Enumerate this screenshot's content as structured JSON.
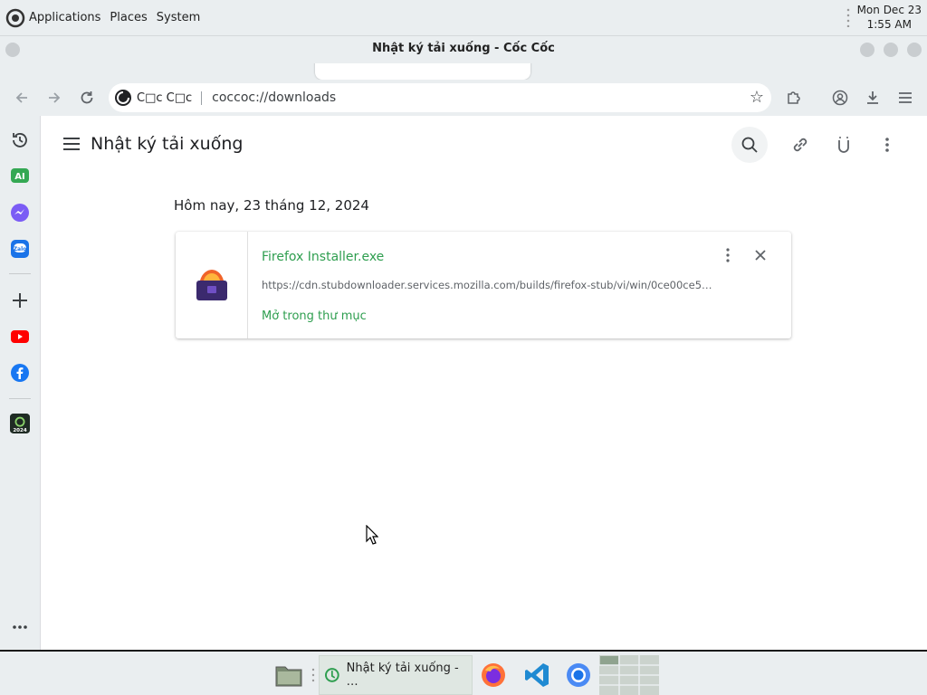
{
  "system_panel": {
    "menus": [
      "Applications",
      "Places",
      "System"
    ],
    "clock": {
      "date": "Mon Dec 23",
      "time": "1:55 AM"
    }
  },
  "window": {
    "title": "Nhật ký tải xuống - Cốc Cốc"
  },
  "toolbar": {
    "site_name": "C□c C□c",
    "url": "coccoc://downloads"
  },
  "sidebar": {
    "items": [
      "history",
      "ai",
      "messenger",
      "zalo",
      "add",
      "youtube",
      "facebook",
      "coccoc-2024",
      "more"
    ]
  },
  "downloads": {
    "heading": "Nhật ký tải xuống",
    "date_group": "Hôm nay, 23 tháng 12, 2024",
    "items": [
      {
        "file_name": "Firefox Installer.exe",
        "url": "https://cdn.stubdownloader.services.mozilla.com/builds/firefox-stub/vi/win/0ce00ce5…",
        "open_folder_label": "Mở trong thư mục"
      }
    ]
  },
  "taskbar": {
    "active_window_label": "Nhật ký tải xuống - …"
  },
  "colors": {
    "accent_green": "#2e9e4f",
    "panel_bg": "#eaeef0"
  }
}
